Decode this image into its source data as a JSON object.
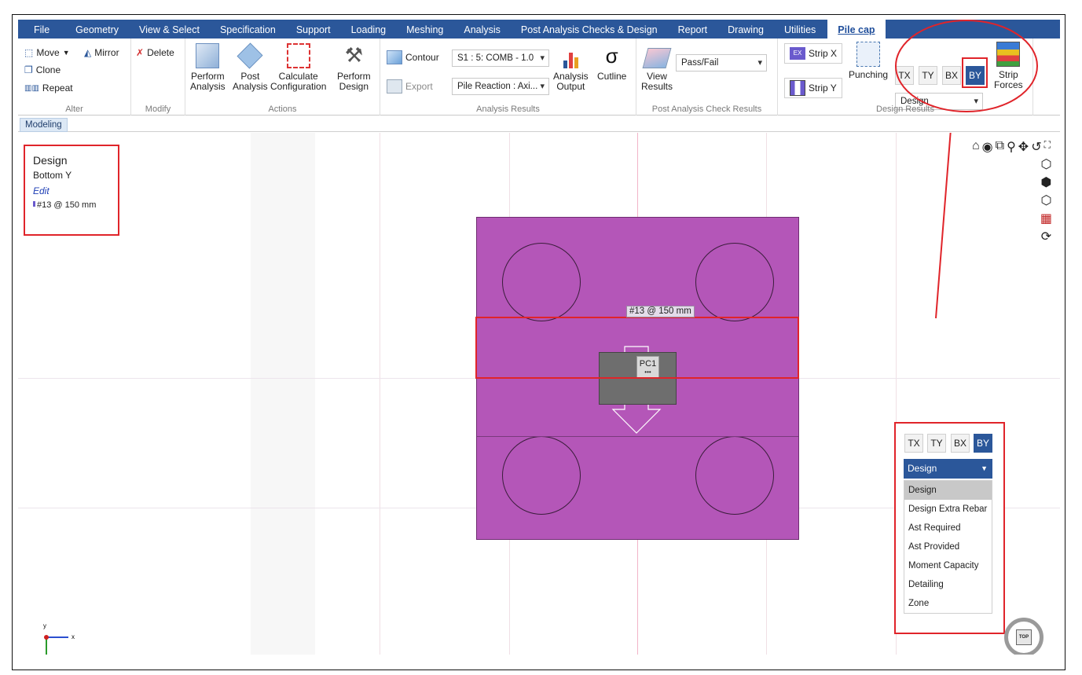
{
  "menu": [
    "File",
    "Geometry",
    "View & Select",
    "Specification",
    "Support",
    "Loading",
    "Meshing",
    "Analysis",
    "Post Analysis Checks & Design",
    "Report",
    "Drawing",
    "Utilities",
    "Pile cap"
  ],
  "ribbon": {
    "alter": {
      "move": "Move",
      "mirror": "Mirror",
      "clone": "Clone",
      "repeat": "Repeat",
      "label": "Alter"
    },
    "modify": {
      "delete": "Delete",
      "label": "Modify"
    },
    "actions": {
      "perform_analysis": [
        "Perform",
        "Analysis"
      ],
      "post_analysis": [
        "Post",
        "Analysis"
      ],
      "calculate_configuration": [
        "Calculate",
        "Configuration"
      ],
      "perform_design": [
        "Perform",
        "Design"
      ],
      "label": "Actions"
    },
    "analysis_results": {
      "contour": "Contour",
      "export": "Export",
      "combo_load": "S1 : 5: COMB - 1.0",
      "combo_result": "Pile Reaction : Axi...",
      "analysis_output": [
        "Analysis",
        "Output"
      ],
      "cutline": "Cutline",
      "label": "Analysis Results"
    },
    "post_check": {
      "view_results": [
        "View",
        "Results"
      ],
      "passfail": "Pass/Fail",
      "label": "Post Analysis Check Results"
    },
    "design_results": {
      "strip_x": "Strip X",
      "strip_y": "Strip Y",
      "punching": "Punching",
      "dirs": [
        "TX",
        "TY",
        "BX",
        "BY"
      ],
      "design_combo": "Design",
      "strip_forces": [
        "Strip",
        "Forces"
      ],
      "label": "Design Results"
    }
  },
  "tab": "Modeling",
  "info": {
    "title": "Design",
    "subtitle": "Bottom Y",
    "edit": "Edit",
    "rebar": "#13  @ 150 mm"
  },
  "canvas": {
    "rebar_label": "#13  @ 150 mm",
    "pc_label": "PC1",
    "pc_dots": "•••"
  },
  "axis": {
    "x": "x",
    "y": "y"
  },
  "popup": {
    "dirs": [
      "TX",
      "TY",
      "BX",
      "BY"
    ],
    "selected": "Design",
    "options": [
      "Design",
      "Design Extra Rebar",
      "Ast Required",
      "Ast Provided",
      "Moment Capacity",
      "Detailing",
      "Zone"
    ]
  },
  "cube": "TOP",
  "colors": {
    "ribbon_blue": "#2b579a",
    "plate": "#b456b8",
    "highlight": "#e0242a"
  }
}
